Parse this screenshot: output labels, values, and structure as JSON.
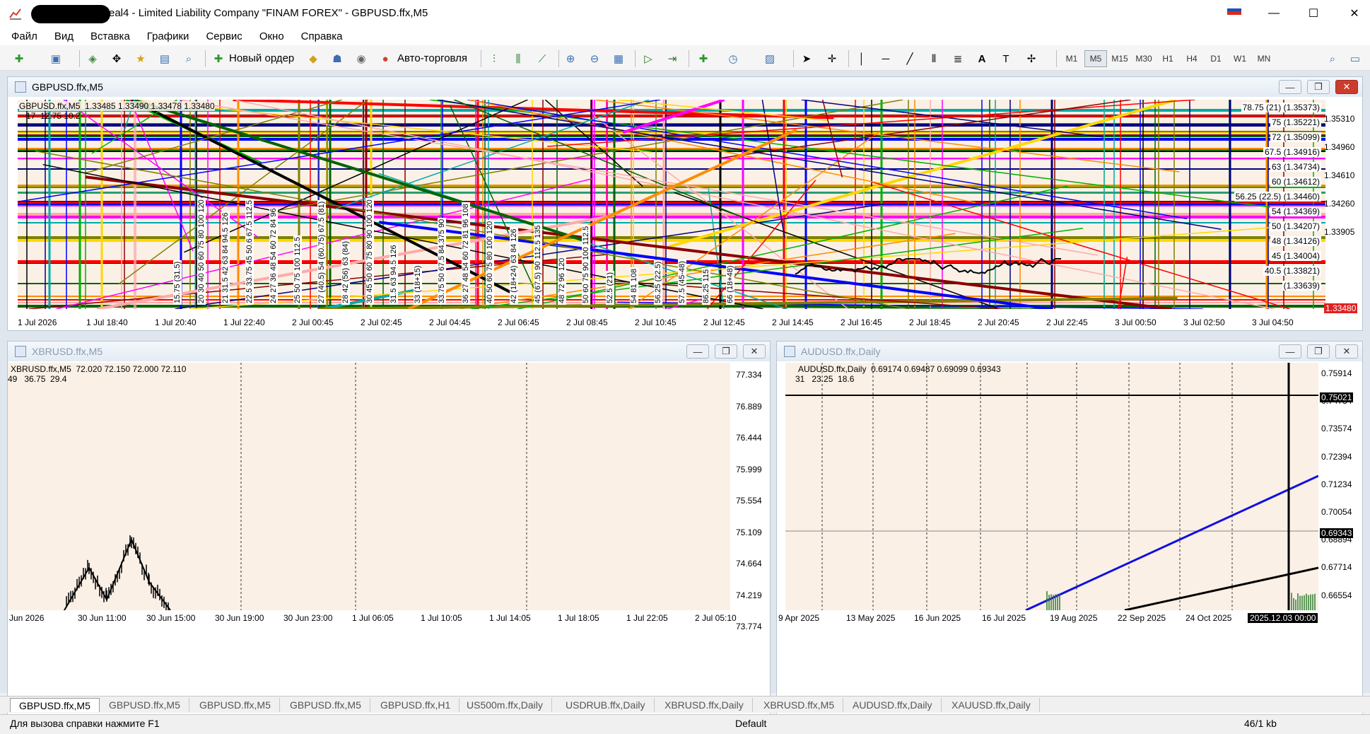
{
  "window": {
    "title": "eal4 - Limited Liability Company \"FINAM FOREX\" - GBPUSD.ffx,M5",
    "minimize": "—",
    "maximize": "☐",
    "close": "✕"
  },
  "menu": [
    "Файл",
    "Вид",
    "Вставка",
    "Графики",
    "Сервис",
    "Окно",
    "Справка"
  ],
  "toolbar": {
    "new_order": "Новый ордер",
    "auto_trading": "Авто-торговля",
    "timeframes": [
      "M1",
      "M5",
      "M15",
      "M30",
      "H1",
      "H4",
      "D1",
      "W1",
      "MN"
    ],
    "active_timeframe": "M5"
  },
  "charts": {
    "gbpusd": {
      "caption": "GBPUSD.ffx,M5",
      "info_line1": "GBPUSD.ffx,M5  1.33485 1.33490 1.33478 1.33480",
      "info_line2": "17  12.75 10.2",
      "price_labels": [
        "1.35310",
        "1.34960",
        "1.34610",
        "1.34260",
        "1.33905"
      ],
      "level_labels": [
        "78.75 (21) (1.35373)",
        "75 (1.35221)",
        "72 (1.35099)",
        "67.5 (1.34916)",
        "63 (1.34734)",
        "60 (1.34612)",
        "56.25 (22.5) (1.34460)",
        "54 (1.34369)",
        "50 (1.34207)",
        "48 (1.34126)",
        "45 (1.34004)",
        "40.5 (1.33821)",
        "(1.33639)"
      ],
      "current_price": "1.33480",
      "time_labels": [
        "1 Jul 2026",
        "1 Jul 18:40",
        "1 Jul 20:40",
        "1 Jul 22:40",
        "2 Jul 00:45",
        "2 Jul 02:45",
        "2 Jul 04:45",
        "2 Jul 06:45",
        "2 Jul 08:45",
        "2 Jul 10:45",
        "2 Jul 12:45",
        "2 Jul 14:45",
        "2 Jul 16:45",
        "2 Jul 18:45",
        "2 Jul 20:45",
        "2 Jul 22:45",
        "3 Jul 00:50",
        "3 Jul 02:50",
        "3 Jul 04:50"
      ],
      "vertical_labels": [
        "15.75 (31.5)",
        "20 30 40 50 60 75 80 100 120",
        "21 31.5 42 63 84 94.5 126",
        "22.5 33.75 45 50.6 67.5 112.5",
        "24 27 36 48 54 60 72 84 96",
        "25 50 75 100 112.5",
        "27 (40.5) 54 (60.75) 67.5 (81)",
        "28 42 (56) 63 (84)",
        "30 45 50 60 75 80 90 100 120",
        "31.5 63 94.5 126",
        "33 (18+15)",
        "33.75 50 67.5 84.375 90",
        "36 27 48 54 60 72 81 96 108",
        "40 50 60 75 80 100 120",
        "42 (18+24) 63 84 126",
        "45 (67.5) 90 112.5 135",
        "48 72 96 120",
        "50 60 75 90 100 112.5",
        "52.5 (21)",
        "54 81 108",
        "56.25 (22.5)",
        "57.5 (45-48)",
        "86.25 115",
        "66 (18+48)"
      ]
    },
    "xbrusd": {
      "caption": "XBRUSD.ffx,M5",
      "info_line1": "XBRUSD.ffx,M5  72.020 72.150 72.000 72.110",
      "info_line2": "49   36.75  29.4",
      "price_labels": [
        "77.334",
        "76.889",
        "76.444",
        "75.999",
        "75.554",
        "75.109",
        "74.664",
        "74.219",
        "73.774"
      ],
      "time_labels": [
        "Jun 2026",
        "30 Jun 11:00",
        "30 Jun 15:00",
        "30 Jun 19:00",
        "30 Jun 23:00",
        "1 Jul 06:05",
        "1 Jul 10:05",
        "1 Jul 14:05",
        "1 Jul 18:05",
        "1 Jul 22:05",
        "2 Jul 05:10"
      ]
    },
    "audusd": {
      "caption": "AUDUSD.ffx,Daily",
      "info_line1": "AUDUSD.ffx,Daily  0.69174 0.69487 0.69099 0.69343",
      "info_line2": "31   23.25  18.6",
      "price_labels": [
        "0.75914",
        "0.74734",
        "0.73574",
        "0.72394",
        "0.71234",
        "0.70054",
        "0.68894",
        "0.67714",
        "0.66554"
      ],
      "marked_high": "0.75021",
      "current_price": "0.69343",
      "time_labels": [
        "9 Apr 2025",
        "13 May 2025",
        "16 Jun 2025",
        "16 Jul 2025",
        "19 Aug 2025",
        "22 Sep 2025",
        "24 Oct 2025"
      ],
      "cursor_date": "2025.12.03 00:00"
    }
  },
  "tabs": [
    "GBPUSD.ffx,M5",
    "GBPUSD.ffx,M5",
    "GBPUSD.ffx,M5",
    "GBPUSD.ffx,M5",
    "GBPUSD.ffx,H1",
    "US500m.ffx,Daily",
    "USDRUB.ffx,Daily",
    "XBRUSD.ffx,Daily",
    "XBRUSD.ffx,M5",
    "AUDUSD.ffx,Daily",
    "XAUUSD.ffx,Daily"
  ],
  "status": {
    "help": "Для вызова справки нажмите F1",
    "profile": "Default",
    "traffic": "46/1 kb"
  }
}
